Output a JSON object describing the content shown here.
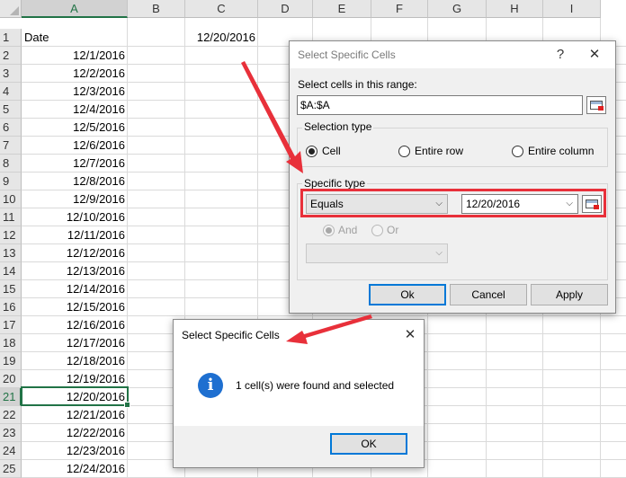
{
  "sheet": {
    "columns": [
      "A",
      "B",
      "C",
      "D",
      "E",
      "F",
      "G",
      "H",
      "I"
    ],
    "rows": [
      "1",
      "2",
      "3",
      "4",
      "5",
      "6",
      "7",
      "8",
      "9",
      "10",
      "11",
      "12",
      "13",
      "14",
      "15",
      "16",
      "17",
      "18",
      "19",
      "20",
      "21",
      "22",
      "23",
      "24",
      "25"
    ],
    "colA": [
      "Date",
      "12/1/2016",
      "12/2/2016",
      "12/3/2016",
      "12/4/2016",
      "12/5/2016",
      "12/6/2016",
      "12/7/2016",
      "12/8/2016",
      "12/9/2016",
      "12/10/2016",
      "12/11/2016",
      "12/12/2016",
      "12/13/2016",
      "12/14/2016",
      "12/15/2016",
      "12/16/2016",
      "12/17/2016",
      "12/18/2016",
      "12/19/2016",
      "12/20/2016",
      "12/21/2016",
      "12/22/2016",
      "12/23/2016",
      "12/24/2016"
    ],
    "c1": "12/20/2016",
    "selected_row": "21"
  },
  "dialog": {
    "title": "Select Specific Cells",
    "help": "?",
    "close": "✕",
    "range_label": "Select cells in this range:",
    "range_value": "$A:$A",
    "selection_type_label": "Selection type",
    "opt_cell": "Cell",
    "opt_entire_row": "Entire row",
    "opt_entire_column": "Entire column",
    "specific_type_label": "Specific type",
    "operator1": "Equals",
    "value1": "12/20/2016",
    "opt_and": "And",
    "opt_or": "Or",
    "operator2": "",
    "ok": "Ok",
    "cancel": "Cancel",
    "apply": "Apply"
  },
  "result": {
    "title": "Select Specific Cells",
    "close": "✕",
    "icon_glyph": "i",
    "message": "1 cell(s) were found and selected",
    "ok": "OK"
  },
  "colors": {
    "excel_green": "#217346",
    "annotation_red": "#e8303a",
    "focus_blue": "#0078d7",
    "info_blue": "#1e6fd0"
  }
}
